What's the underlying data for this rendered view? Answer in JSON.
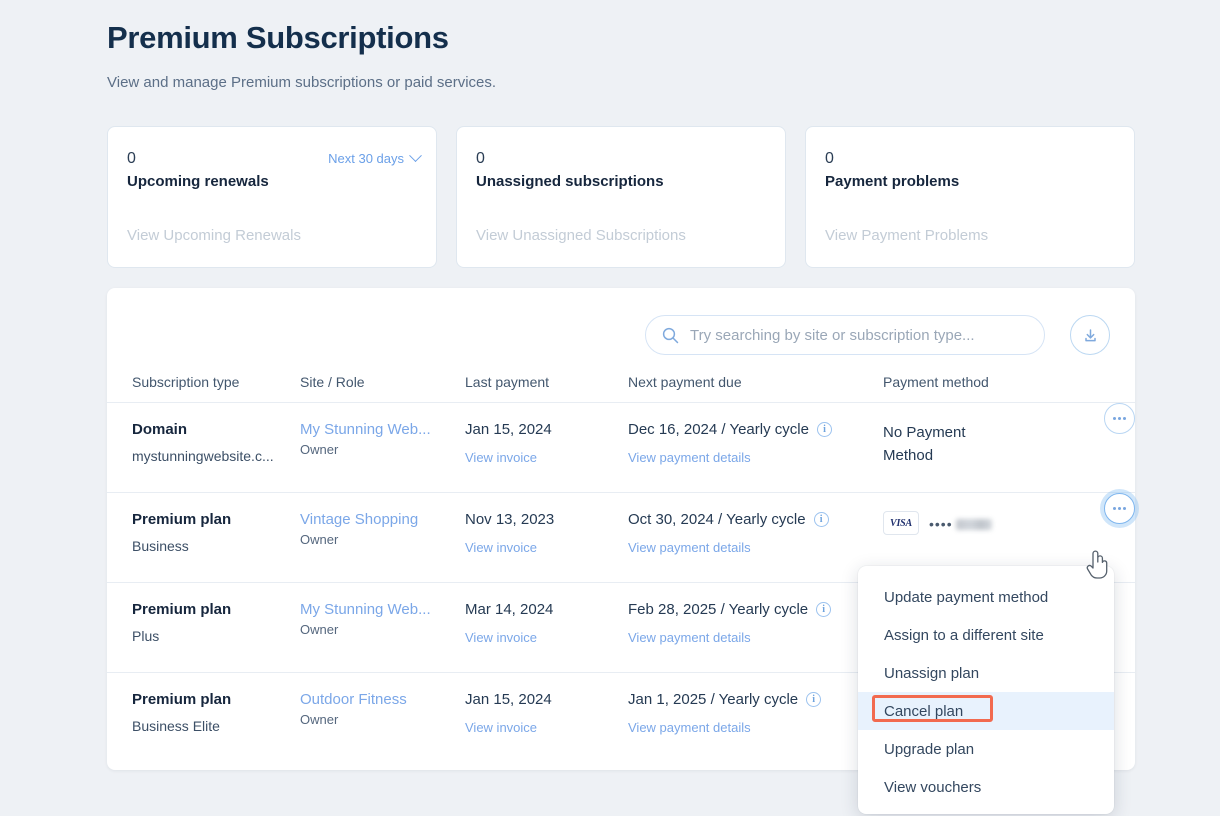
{
  "header": {
    "title": "Premium Subscriptions",
    "subtitle": "View and manage Premium subscriptions or paid services."
  },
  "cards": [
    {
      "count": "0",
      "label": "Upcoming renewals",
      "link": "View Upcoming Renewals",
      "select": "Next 30 days"
    },
    {
      "count": "0",
      "label": "Unassigned subscriptions",
      "link": "View Unassigned Subscriptions"
    },
    {
      "count": "0",
      "label": "Payment problems",
      "link": "View Payment Problems"
    }
  ],
  "search": {
    "placeholder": "Try searching by site or subscription type...",
    "value": ""
  },
  "table": {
    "columns": [
      "Subscription type",
      "Site / Role",
      "Last payment",
      "Next payment due",
      "Payment method"
    ],
    "rows": [
      {
        "type": "Domain",
        "type_sub": "mystunningwebsite.c...",
        "site": "My Stunning Web...",
        "role": "Owner",
        "last_payment": "Jan 15, 2024",
        "invoice_link": "View invoice",
        "next_due": "Dec 16, 2024 / Yearly cycle",
        "details_link": "View payment details",
        "payment_method": "No Payment Method",
        "card_brand": null,
        "card_mask": null
      },
      {
        "type": "Premium plan",
        "type_sub": "Business",
        "site": "Vintage Shopping",
        "role": "Owner",
        "last_payment": "Nov 13, 2023",
        "invoice_link": "View invoice",
        "next_due": "Oct 30, 2024 / Yearly cycle",
        "details_link": "View payment details",
        "payment_method": null,
        "card_brand": "VISA",
        "card_mask": "••••"
      },
      {
        "type": "Premium plan",
        "type_sub": "Plus",
        "site": "My Stunning Web...",
        "role": "Owner",
        "last_payment": "Mar 14, 2024",
        "invoice_link": "View invoice",
        "next_due": "Feb 28, 2025 / Yearly cycle",
        "details_link": "View payment details",
        "payment_method": null,
        "card_brand": null,
        "card_mask": null
      },
      {
        "type": "Premium plan",
        "type_sub": "Business Elite",
        "site": "Outdoor Fitness",
        "role": "Owner",
        "last_payment": "Jan 15, 2024",
        "invoice_link": "View invoice",
        "next_due": "Jan 1, 2025 / Yearly cycle",
        "details_link": "View payment details",
        "payment_method": null,
        "card_brand": null,
        "card_mask": null
      }
    ]
  },
  "dropdown": {
    "items": [
      "Update payment method",
      "Assign to a different site",
      "Unassign plan",
      "Cancel plan",
      "Upgrade plan",
      "View vouchers"
    ],
    "highlighted": "Cancel plan"
  },
  "colors": {
    "page_background": "#eef1f5",
    "title": "#142f4c",
    "link": "#7ba7e8",
    "accent_blue": "#6ba0e8",
    "annotation_red": "#f26a4f",
    "highlight_row": "#e8f2fd"
  },
  "icons": {
    "search": "search-icon",
    "download": "download-icon",
    "info": "info-icon",
    "more": "more-options-icon",
    "chevron": "chevron-down-icon"
  }
}
